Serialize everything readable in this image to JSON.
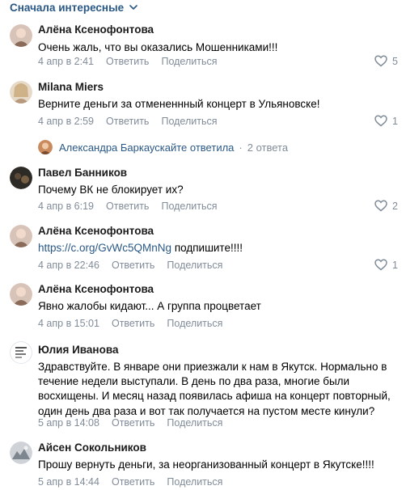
{
  "sort": {
    "label": "Сначала интересные"
  },
  "comments": [
    {
      "author": "Алёна Ксенофонтова",
      "text": "Очень жаль, что вы оказались Мошенниками!!!",
      "date": "4 апр в 2:41",
      "reply": "Ответить",
      "share": "Поделиться",
      "likes": "5"
    },
    {
      "author": "Milana Miers",
      "text": "Верните деньги за отмененнный концерт в Ульяновске!",
      "date": "4 апр в 2:59",
      "reply": "Ответить",
      "share": "Поделиться",
      "likes": "1"
    },
    {
      "author": "Павел Банников",
      "text": "Почему ВК не блокирует их?",
      "date": "4 апр в 6:19",
      "reply": "Ответить",
      "share": "Поделиться",
      "likes": "2"
    },
    {
      "author": "Алёна Ксенофонтова",
      "link": "https://c.org/GvWc5QMnNg",
      "text": "подпишите!!!!",
      "date": "4 апр в 22:46",
      "reply": "Ответить",
      "share": "Поделиться",
      "likes": "1"
    },
    {
      "author": "Алёна Ксенофонтова",
      "text": "Явно жалобы кидают... А группа процветает",
      "date": "4 апр в 15:01",
      "reply": "Ответить",
      "share": "Поделиться"
    },
    {
      "author": "Юлия Иванова",
      "text_lines": [
        "Здравствуйте. В январе они приезжали к нам в Якутск. Нормально в",
        "течение недели выступали. В день по два раза, многие были",
        "восхищены. И месяц назад появилась афиша на концерт повторный,",
        "один день два раза и вот так получается на пустом месте кинули?"
      ],
      "date": "5 апр в 14:08",
      "reply": "Ответить",
      "share": "Поделиться"
    },
    {
      "author": "Айсен Сокольников",
      "text": "Прошу вернуть деньги, за неорганизованный концерт в Якутске!!!!",
      "date": "5 апр в 14:44",
      "reply": "Ответить",
      "share": "Поделиться"
    }
  ],
  "thread": {
    "author": "Александра Баркаускайте ответила",
    "separator": "·",
    "count": "2 ответа"
  },
  "icons": {
    "sort": "chevron-down-icon",
    "like": "heart-icon"
  },
  "colors": {
    "link": "#2a5885",
    "meta": "#818c99",
    "text": "#000000"
  }
}
